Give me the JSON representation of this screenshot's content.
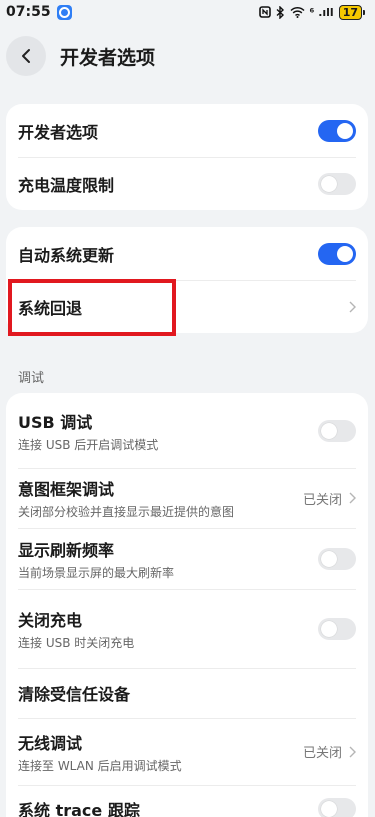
{
  "status_bar": {
    "time": "07:55",
    "signal": "⁶ .ıll",
    "battery": "17"
  },
  "header": {
    "title": "开发者选项"
  },
  "card1": {
    "developer_options": {
      "label": "开发者选项",
      "enabled": true
    },
    "charging_temp_limit": {
      "label": "充电温度限制",
      "enabled": false
    }
  },
  "card2": {
    "auto_system_update": {
      "label": "自动系统更新",
      "enabled": true
    },
    "system_rollback": {
      "label": "系统回退"
    }
  },
  "section_debug": {
    "label": "调试"
  },
  "card3": {
    "usb_debugging": {
      "label": "USB 调试",
      "sub": "连接 USB 后开启调试模式",
      "enabled": false
    },
    "intent_framework_debug": {
      "label": "意图框架调试",
      "sub": "关闭部分校验并直接显示最近提供的意图",
      "value": "已关闭"
    },
    "show_refresh_rate": {
      "label": "显示刷新频率",
      "sub": "当前场景显示屏的最大刷新率",
      "enabled": false
    },
    "disable_charging": {
      "label": "关闭充电",
      "sub": "连接 USB 时关闭充电",
      "enabled": false
    },
    "clear_trusted_devices": {
      "label": "清除受信任设备"
    },
    "wireless_debugging": {
      "label": "无线调试",
      "sub": "连接至 WLAN 后启用调试模式",
      "value": "已关闭"
    },
    "system_trace": {
      "label": "系统 trace 跟踪",
      "enabled": false
    }
  },
  "colors": {
    "accent": "#2466f2",
    "highlight": "#e1181f"
  }
}
